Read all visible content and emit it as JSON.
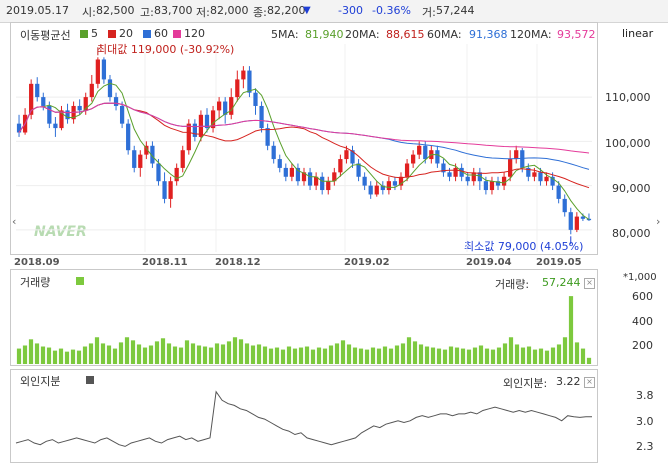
{
  "header": {
    "date": "2019.05.17",
    "open_label": "시:",
    "open": "82,500",
    "high_label": "고:",
    "high": "83,700",
    "low_label": "저:",
    "low": "82,000",
    "close_label": "종:",
    "close": "82,200",
    "change_arrow": "▼",
    "change": "-300",
    "change_pct": "-0.36%",
    "volume_label": "거:",
    "volume": "57,244"
  },
  "scale_label": "linear",
  "ma": {
    "title": "이동평균선",
    "legend": [
      {
        "label": "5",
        "color": "#5aa02c"
      },
      {
        "label": "20",
        "color": "#d6231f"
      },
      {
        "label": "60",
        "color": "#2e6fd6"
      },
      {
        "label": "120",
        "color": "#e43b9a"
      }
    ],
    "values": [
      {
        "label": "5MA:",
        "value": "81,940",
        "color": "#5aa02c"
      },
      {
        "label": "20MA:",
        "value": "88,615",
        "color": "#c0211d"
      },
      {
        "label": "60MA:",
        "value": "91,368",
        "color": "#2e6fd6"
      },
      {
        "label": "120MA:",
        "value": "93,572",
        "color": "#e43b9a"
      }
    ]
  },
  "price_axis": [
    "110,000",
    "100,000",
    "90,000",
    "80,000"
  ],
  "max_note": "최대값 119,000 (-30.92%)",
  "min_note": "최소값 79,000 (4.05%)",
  "watermark": "NAVER",
  "dates": [
    "2018.09",
    "2018.11",
    "2018.12",
    "2019.02",
    "2019.04",
    "2019.05"
  ],
  "volume_panel": {
    "title": "거래량",
    "value_label": "거래량:",
    "value": "57,244",
    "unit": "*1,000",
    "axis": [
      "600",
      "400",
      "200"
    ],
    "color": "#7dc93e"
  },
  "foreign_panel": {
    "title": "외인지분",
    "value_label": "외인지분:",
    "value": "3.22",
    "axis": [
      "3.8",
      "3.0",
      "2.3"
    ],
    "color": "#555555"
  },
  "chart_data": {
    "type": "line",
    "price": {
      "ylim": [
        75000,
        122000
      ],
      "candles": [
        [
          104000,
          102000,
          106000,
          101000
        ],
        [
          102000,
          106000,
          107500,
          101500
        ],
        [
          106000,
          113000,
          114000,
          105000
        ],
        [
          113000,
          110000,
          114500,
          109000
        ],
        [
          110000,
          108000,
          111000,
          107000
        ],
        [
          108000,
          104000,
          109000,
          103000
        ],
        [
          104000,
          103000,
          105500,
          101000
        ],
        [
          103000,
          107000,
          108000,
          102500
        ],
        [
          107000,
          105000,
          108500,
          104000
        ],
        [
          105000,
          108000,
          109000,
          104000
        ],
        [
          108000,
          107000,
          109500,
          106000
        ],
        [
          107000,
          110000,
          111000,
          106000
        ],
        [
          110000,
          113000,
          115000,
          109000
        ],
        [
          113000,
          118500,
          119000,
          112000
        ],
        [
          118500,
          114000,
          119000,
          113000
        ],
        [
          114000,
          110000,
          115000,
          109000
        ],
        [
          110000,
          108000,
          111000,
          107000
        ],
        [
          108000,
          104000,
          109000,
          103000
        ],
        [
          104000,
          98000,
          105000,
          97000
        ],
        [
          98000,
          94000,
          99000,
          93000
        ],
        [
          94000,
          97000,
          98000,
          92000
        ],
        [
          97000,
          99000,
          100000,
          96000
        ],
        [
          99000,
          95000,
          100000,
          94000
        ],
        [
          95000,
          91000,
          96000,
          90000
        ],
        [
          91000,
          87000,
          93000,
          86000
        ],
        [
          87000,
          91000,
          92000,
          85000
        ],
        [
          91000,
          94000,
          95000,
          90000
        ],
        [
          94000,
          98000,
          99000,
          93000
        ],
        [
          98000,
          104000,
          105000,
          97000
        ],
        [
          104000,
          101000,
          105000,
          100000
        ],
        [
          101000,
          106000,
          107000,
          100000
        ],
        [
          106000,
          103000,
          107500,
          102000
        ],
        [
          103000,
          107000,
          108000,
          102000
        ],
        [
          107000,
          109000,
          110000,
          105000
        ],
        [
          109000,
          106000,
          110000,
          104000
        ],
        [
          106000,
          110000,
          112000,
          105000
        ],
        [
          110000,
          114000,
          116000,
          109000
        ],
        [
          114000,
          116000,
          117000,
          112000
        ],
        [
          116000,
          111000,
          117000,
          110000
        ],
        [
          111000,
          108000,
          112000,
          106000
        ],
        [
          108000,
          103000,
          109000,
          102000
        ],
        [
          103000,
          99000,
          104000,
          98000
        ],
        [
          99000,
          96000,
          100000,
          95000
        ],
        [
          96000,
          94000,
          97000,
          93000
        ],
        [
          94000,
          92000,
          95000,
          91000
        ],
        [
          92000,
          94000,
          95000,
          91000
        ],
        [
          94000,
          91000,
          95000,
          90000
        ],
        [
          91000,
          93000,
          94000,
          90000
        ],
        [
          93000,
          90000,
          94000,
          89000
        ],
        [
          90000,
          92000,
          93000,
          89000
        ],
        [
          92000,
          89000,
          93000,
          88000
        ],
        [
          89000,
          91000,
          92000,
          88000
        ],
        [
          91000,
          93000,
          94000,
          90000
        ],
        [
          93000,
          96000,
          97000,
          92000
        ],
        [
          96000,
          98000,
          99000,
          95000
        ],
        [
          98000,
          95000,
          99000,
          94000
        ],
        [
          95000,
          92000,
          96000,
          91000
        ],
        [
          92000,
          90000,
          93000,
          89000
        ],
        [
          90000,
          88000,
          91000,
          87000
        ],
        [
          88000,
          90000,
          91000,
          87500
        ],
        [
          90000,
          89000,
          91000,
          88000
        ],
        [
          89000,
          91000,
          92000,
          88000
        ],
        [
          91000,
          90000,
          92000,
          89000
        ],
        [
          90000,
          92000,
          93000,
          89000
        ],
        [
          92000,
          95000,
          96000,
          91000
        ],
        [
          95000,
          97000,
          98000,
          94000
        ],
        [
          97000,
          99000,
          100000,
          96000
        ],
        [
          99000,
          96000,
          100000,
          95000
        ],
        [
          96000,
          98000,
          99000,
          95000
        ],
        [
          98000,
          95000,
          99000,
          94000
        ],
        [
          95000,
          93000,
          96000,
          92000
        ],
        [
          93000,
          92000,
          94000,
          91000
        ],
        [
          92000,
          94000,
          95000,
          91000
        ],
        [
          94000,
          92000,
          95000,
          91000
        ],
        [
          92000,
          91000,
          93000,
          90000
        ],
        [
          91000,
          93000,
          94000,
          90000
        ],
        [
          93000,
          91000,
          94000,
          89000
        ],
        [
          91000,
          89000,
          92000,
          88000
        ],
        [
          89000,
          91000,
          92000,
          88000
        ],
        [
          91000,
          90000,
          92000,
          89000
        ],
        [
          90000,
          92000,
          93000,
          89000
        ],
        [
          92000,
          96000,
          98000,
          91000
        ],
        [
          96000,
          98000,
          99000,
          95000
        ],
        [
          98000,
          94000,
          98500,
          93000
        ],
        [
          94000,
          92000,
          95000,
          91000
        ],
        [
          92000,
          93000,
          94000,
          91000
        ],
        [
          93000,
          91000,
          94000,
          90000
        ],
        [
          91000,
          92000,
          93000,
          90000
        ],
        [
          92000,
          90000,
          93000,
          89000
        ],
        [
          90000,
          87000,
          91000,
          86000
        ],
        [
          87000,
          84000,
          88000,
          83000
        ],
        [
          84000,
          80000,
          85000,
          79000
        ],
        [
          80000,
          83000,
          84000,
          79500
        ],
        [
          83000,
          82500,
          83700,
          82000
        ],
        [
          82500,
          82200,
          83700,
          82000
        ]
      ]
    },
    "volume": {
      "ylim": [
        0,
        700
      ],
      "values": [
        150,
        180,
        240,
        200,
        170,
        160,
        130,
        150,
        120,
        140,
        130,
        170,
        200,
        260,
        200,
        180,
        150,
        210,
        260,
        230,
        190,
        160,
        180,
        220,
        250,
        200,
        170,
        160,
        230,
        200,
        180,
        170,
        160,
        200,
        190,
        220,
        260,
        240,
        200,
        180,
        190,
        170,
        150,
        160,
        140,
        170,
        150,
        160,
        170,
        140,
        160,
        150,
        180,
        200,
        230,
        190,
        160,
        150,
        140,
        160,
        150,
        170,
        150,
        180,
        200,
        260,
        220,
        190,
        170,
        160,
        150,
        140,
        170,
        160,
        150,
        140,
        160,
        180,
        150,
        140,
        160,
        200,
        260,
        190,
        160,
        170,
        140,
        150,
        130,
        160,
        190,
        260,
        660,
        210,
        150,
        60
      ]
    },
    "foreign": {
      "ylim": [
        2.1,
        4.0
      ],
      "values": [
        2.45,
        2.5,
        2.55,
        2.45,
        2.4,
        2.5,
        2.55,
        2.45,
        2.5,
        2.55,
        2.6,
        2.55,
        2.5,
        2.45,
        2.55,
        2.6,
        2.5,
        2.4,
        2.35,
        2.45,
        2.5,
        2.55,
        2.6,
        2.5,
        2.45,
        2.55,
        2.6,
        2.65,
        2.55,
        2.6,
        2.5,
        2.55,
        2.6,
        3.95,
        3.7,
        3.6,
        3.55,
        3.45,
        3.4,
        3.3,
        3.2,
        3.15,
        3.05,
        2.95,
        2.85,
        2.8,
        2.7,
        2.75,
        2.6,
        2.55,
        2.5,
        2.45,
        2.4,
        2.45,
        2.5,
        2.55,
        2.6,
        2.75,
        2.85,
        2.95,
        2.9,
        3.0,
        3.05,
        3.1,
        3.05,
        3.1,
        3.2,
        3.25,
        3.2,
        3.25,
        3.3,
        3.3,
        3.25,
        3.3,
        3.3,
        3.35,
        3.3,
        3.4,
        3.45,
        3.5,
        3.45,
        3.4,
        3.35,
        3.4,
        3.35,
        3.4,
        3.35,
        3.3,
        3.25,
        3.2,
        3.1,
        3.25,
        3.22,
        3.2,
        3.22,
        3.22
      ]
    }
  }
}
